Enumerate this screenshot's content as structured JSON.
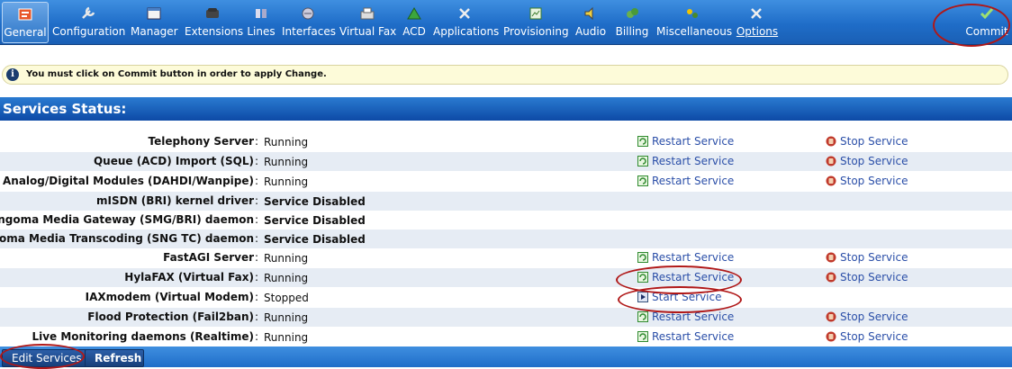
{
  "toolbar": {
    "items": [
      {
        "label": "General",
        "icon": "general-icon"
      },
      {
        "label": "Configuration",
        "icon": "wrench-icon"
      },
      {
        "label": "Manager",
        "icon": "calendar-icon"
      },
      {
        "label": "Extensions",
        "icon": "phone-icon"
      },
      {
        "label": "Lines",
        "icon": "lines-icon"
      },
      {
        "label": "Interfaces",
        "icon": "interfaces-icon"
      },
      {
        "label": "Virtual Fax",
        "icon": "fax-icon"
      },
      {
        "label": "ACD",
        "icon": "acd-icon"
      },
      {
        "label": "Applications",
        "icon": "tools-icon"
      },
      {
        "label": "Provisioning",
        "icon": "provisioning-icon"
      },
      {
        "label": "Audio",
        "icon": "audio-icon"
      },
      {
        "label": "Billing",
        "icon": "billing-icon"
      },
      {
        "label": "Miscellaneous",
        "icon": "misc-icon"
      },
      {
        "label": "Options",
        "icon": "options-icon"
      }
    ],
    "commit_label": "Commit"
  },
  "notice": {
    "text": "You must click on Commit button in order to apply Change."
  },
  "section": {
    "title": "Services Status:"
  },
  "services": [
    {
      "name": "Telephony Server",
      "status": "Running",
      "restart": "Restart Service",
      "stop": "Stop Service"
    },
    {
      "name": "Queue (ACD) Import (SQL)",
      "status": "Running",
      "restart": "Restart Service",
      "stop": "Stop Service"
    },
    {
      "name": "Analog/Digital Modules (DAHDI/Wanpipe)",
      "status": "Running",
      "restart": "Restart Service",
      "stop": "Stop Service"
    },
    {
      "name": "mISDN (BRI) kernel driver",
      "status": "Service Disabled"
    },
    {
      "name": "Sangoma Media Gateway (SMG/BRI) daemon",
      "status": "Service Disabled"
    },
    {
      "name": "Sangoma Media Transcoding (SNG TC) daemon",
      "status": "Service Disabled"
    },
    {
      "name": "FastAGI Server",
      "status": "Running",
      "restart": "Restart Service",
      "stop": "Stop Service"
    },
    {
      "name": "HylaFAX (Virtual Fax)",
      "status": "Running",
      "restart": "Restart Service",
      "stop": "Stop Service"
    },
    {
      "name": "IAXmodem (Virtual Modem)",
      "status": "Stopped",
      "start": "Start Service"
    },
    {
      "name": "Flood Protection (Fail2ban)",
      "status": "Running",
      "restart": "Restart Service",
      "stop": "Stop Service"
    },
    {
      "name": "Live Monitoring daemons (Realtime)",
      "status": "Running",
      "restart": "Restart Service",
      "stop": "Stop Service"
    }
  ],
  "colon": ":",
  "buttons": {
    "edit_services": "Edit Services",
    "refresh": "Refresh"
  },
  "colors": {
    "toolbar": "#1f6dc8",
    "header": "#0d4aa6",
    "link": "#2b4fa8",
    "annotation": "#b01818",
    "alt_row": "#e6ecf4"
  }
}
